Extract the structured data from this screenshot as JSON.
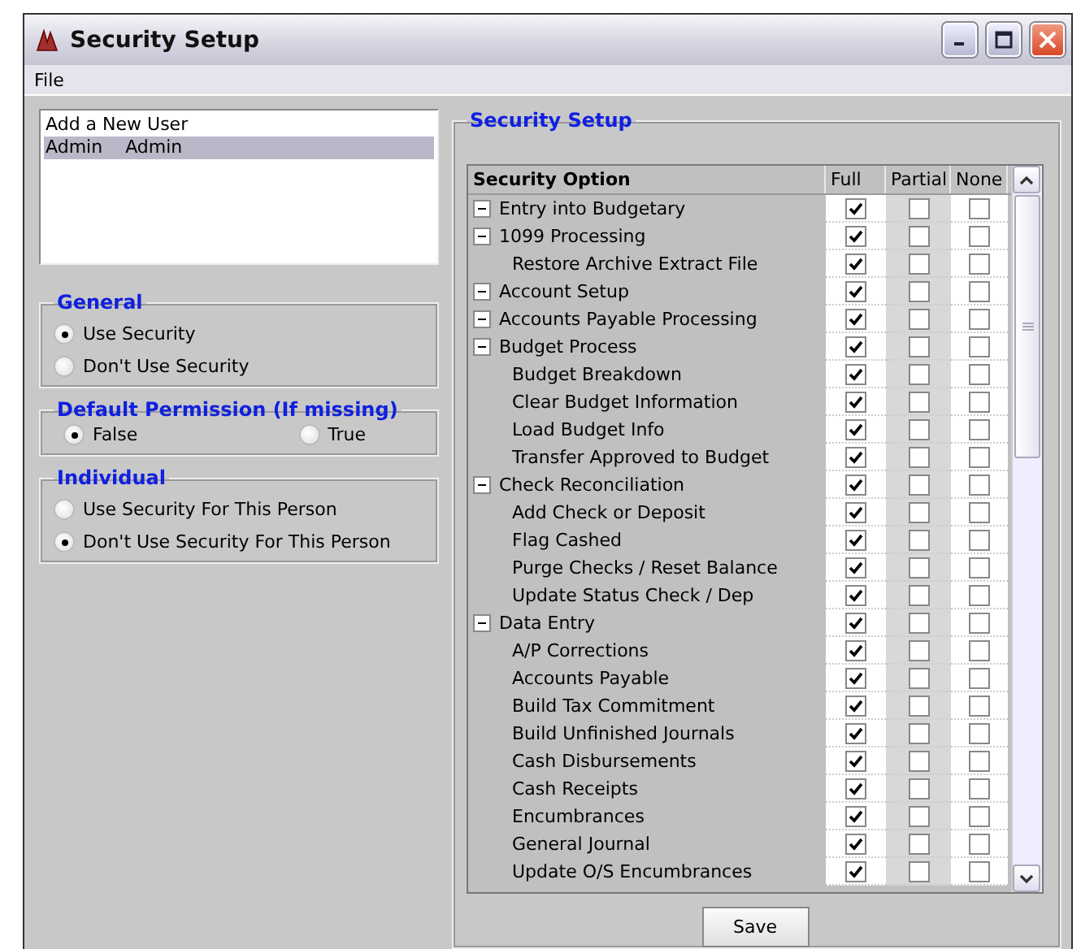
{
  "window": {
    "title": "Security Setup"
  },
  "menu": [
    "File"
  ],
  "users": [
    {
      "name": "Add a New User",
      "selected": false
    },
    {
      "name": "Admin",
      "full_name": "Admin",
      "selected": true
    }
  ],
  "groups": [
    {
      "title": "General",
      "kind": "stacked",
      "options": [
        {
          "label": "Use Security",
          "selected": true
        },
        {
          "label": "Don't Use Security",
          "selected": false
        }
      ]
    },
    {
      "title": "Default Permission (If missing)",
      "kind": "inline",
      "options": [
        {
          "label": "False",
          "selected": true
        },
        {
          "label": "True",
          "selected": false
        }
      ]
    },
    {
      "title": "Individual",
      "kind": "stacked",
      "options": [
        {
          "label": "Use Security For This Person",
          "selected": false
        },
        {
          "label": "Don't Use Security For This Person",
          "selected": true
        }
      ]
    }
  ],
  "security": {
    "title": "Security Setup",
    "columns": [
      "Security Option",
      "Full",
      "Partial",
      "None"
    ],
    "rows": [
      {
        "label": "Entry into Budgetary",
        "expanded": true,
        "full": true,
        "partial": false,
        "none": false
      },
      {
        "label": "1099 Processing",
        "expanded": true,
        "full": true,
        "partial": false,
        "none": false,
        "children": [
          {
            "label": "Restore Archive Extract File",
            "full": true,
            "partial": false,
            "none": false
          }
        ]
      },
      {
        "label": "Account Setup",
        "expanded": true,
        "full": true,
        "partial": false,
        "none": false
      },
      {
        "label": "Accounts Payable Processing",
        "expanded": true,
        "full": true,
        "partial": false,
        "none": false
      },
      {
        "label": "Budget Process",
        "expanded": true,
        "full": true,
        "partial": false,
        "none": false,
        "children": [
          {
            "label": "Budget Breakdown",
            "full": true,
            "partial": false,
            "none": false
          },
          {
            "label": "Clear Budget Information",
            "full": true,
            "partial": false,
            "none": false
          },
          {
            "label": "Load Budget Info",
            "full": true,
            "partial": false,
            "none": false
          },
          {
            "label": "Transfer Approved to Budget",
            "full": true,
            "partial": false,
            "none": false
          }
        ]
      },
      {
        "label": "Check Reconciliation",
        "expanded": true,
        "full": true,
        "partial": false,
        "none": false,
        "children": [
          {
            "label": "Add Check or Deposit",
            "full": true,
            "partial": false,
            "none": false
          },
          {
            "label": "Flag Cashed",
            "full": true,
            "partial": false,
            "none": false
          },
          {
            "label": "Purge Checks / Reset Balance",
            "full": true,
            "partial": false,
            "none": false
          },
          {
            "label": "Update Status Check / Dep",
            "full": true,
            "partial": false,
            "none": false
          }
        ]
      },
      {
        "label": "Data Entry",
        "expanded": true,
        "full": true,
        "partial": false,
        "none": false,
        "children": [
          {
            "label": "A/P Corrections",
            "full": true,
            "partial": false,
            "none": false
          },
          {
            "label": "Accounts Payable",
            "full": true,
            "partial": false,
            "none": false
          },
          {
            "label": "Build Tax Commitment",
            "full": true,
            "partial": false,
            "none": false
          },
          {
            "label": "Build Unfinished Journals",
            "full": true,
            "partial": false,
            "none": false
          },
          {
            "label": "Cash Disbursements",
            "full": true,
            "partial": false,
            "none": false
          },
          {
            "label": "Cash Receipts",
            "full": true,
            "partial": false,
            "none": false
          },
          {
            "label": "Encumbrances",
            "full": true,
            "partial": false,
            "none": false
          },
          {
            "label": "General Journal",
            "full": true,
            "partial": false,
            "none": false
          },
          {
            "label": "Update O/S Encumbrances",
            "full": true,
            "partial": false,
            "none": false
          }
        ]
      }
    ]
  },
  "save_button": "Save"
}
